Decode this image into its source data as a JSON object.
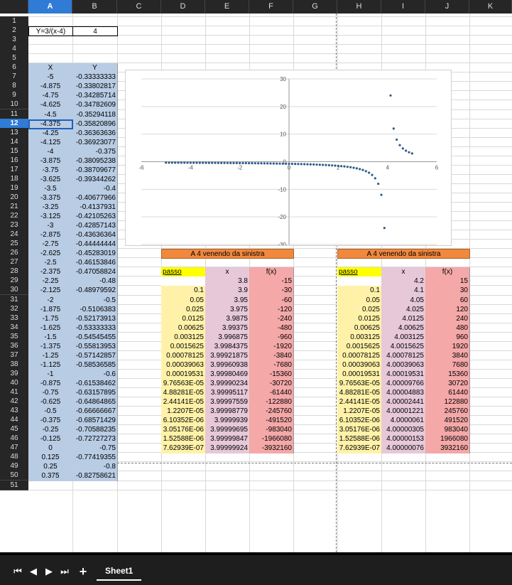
{
  "columns": [
    "A",
    "B",
    "C",
    "D",
    "E",
    "F",
    "G",
    "H",
    "I",
    "J",
    "K"
  ],
  "selected_column": "A",
  "selected_row": 12,
  "formula_label": "Y=3/(x-4)",
  "formula_value": "4",
  "xy_header": [
    "X",
    "Y"
  ],
  "xy_rows": [
    [
      "-5",
      "-0.33333333"
    ],
    [
      "-4.875",
      "-0.33802817"
    ],
    [
      "-4.75",
      "-0.34285714"
    ],
    [
      "-4.625",
      "-0.34782609"
    ],
    [
      "-4.5",
      "-0.35294118"
    ],
    [
      "-4.375",
      "-0.35820896"
    ],
    [
      "-4.25",
      "-0.36363636"
    ],
    [
      "-4.125",
      "-0.36923077"
    ],
    [
      "-4",
      "-0.375"
    ],
    [
      "-3.875",
      "-0.38095238"
    ],
    [
      "-3.75",
      "-0.38709677"
    ],
    [
      "-3.625",
      "-0.39344262"
    ],
    [
      "-3.5",
      "-0.4"
    ],
    [
      "-3.375",
      "-0.40677966"
    ],
    [
      "-3.25",
      "-0.4137931"
    ],
    [
      "-3.125",
      "-0.42105263"
    ],
    [
      "-3",
      "-0.42857143"
    ],
    [
      "-2.875",
      "-0.43636364"
    ],
    [
      "-2.75",
      "-0.44444444"
    ],
    [
      "-2.625",
      "-0.45283019"
    ],
    [
      "-2.5",
      "-0.46153846"
    ],
    [
      "-2.375",
      "-0.47058824"
    ],
    [
      "-2.25",
      "-0.48"
    ],
    [
      "-2.125",
      "-0.48979592"
    ],
    [
      "-2",
      "-0.5"
    ],
    [
      "-1.875",
      "-0.5106383"
    ],
    [
      "-1.75",
      "-0.52173913"
    ],
    [
      "-1.625",
      "-0.53333333"
    ],
    [
      "-1.5",
      "-0.54545455"
    ],
    [
      "-1.375",
      "-0.55813953"
    ],
    [
      "-1.25",
      "-0.57142857"
    ],
    [
      "-1.125",
      "-0.58536585"
    ],
    [
      "-1",
      "-0.6"
    ],
    [
      "-0.875",
      "-0.61538462"
    ],
    [
      "-0.75",
      "-0.63157895"
    ],
    [
      "-0.625",
      "-0.64864865"
    ],
    [
      "-0.5",
      "-0.66666667"
    ],
    [
      "-0.375",
      "-0.68571429"
    ],
    [
      "-0.25",
      "-0.70588235"
    ],
    [
      "-0.125",
      "-0.72727273"
    ],
    [
      "0",
      "-0.75"
    ],
    [
      "0.125",
      "-0.77419355"
    ],
    [
      "0.25",
      "-0.8"
    ],
    [
      "0.375",
      "-0.82758621"
    ]
  ],
  "left_table": {
    "title": "A 4 venendo da sinistra",
    "headers": [
      "passo",
      "x",
      "f(x)"
    ],
    "rows": [
      [
        "",
        "3.8",
        "-15"
      ],
      [
        "0.1",
        "3.9",
        "-30"
      ],
      [
        "0.05",
        "3.95",
        "-60"
      ],
      [
        "0.025",
        "3.975",
        "-120"
      ],
      [
        "0.0125",
        "3.9875",
        "-240"
      ],
      [
        "0.00625",
        "3.99375",
        "-480"
      ],
      [
        "0.003125",
        "3.996875",
        "-960"
      ],
      [
        "0.0015625",
        "3.9984375",
        "-1920"
      ],
      [
        "0.00078125",
        "3.99921875",
        "-3840"
      ],
      [
        "0.00039063",
        "3.99960938",
        "-7680"
      ],
      [
        "0.00019531",
        "3.99980469",
        "-15360"
      ],
      [
        "9.76563E-05",
        "3.99990234",
        "-30720"
      ],
      [
        "4.88281E-05",
        "3.99995117",
        "-61440"
      ],
      [
        "2.44141E-05",
        "3.99997559",
        "-122880"
      ],
      [
        "1.2207E-05",
        "3.99998779",
        "-245760"
      ],
      [
        "6.10352E-06",
        "3.9999939",
        "-491520"
      ],
      [
        "3.05176E-06",
        "3.99999695",
        "-983040"
      ],
      [
        "1.52588E-06",
        "3.99999847",
        "-1966080"
      ],
      [
        "7.62939E-07",
        "3.99999924",
        "-3932160"
      ]
    ]
  },
  "right_table": {
    "title": "A 4 venendo da sinistra",
    "headers": [
      "passo",
      "x",
      "f(x)"
    ],
    "rows": [
      [
        "",
        "4.2",
        "15"
      ],
      [
        "0.1",
        "4.1",
        "30"
      ],
      [
        "0.05",
        "4.05",
        "60"
      ],
      [
        "0.025",
        "4.025",
        "120"
      ],
      [
        "0.0125",
        "4.0125",
        "240"
      ],
      [
        "0.00625",
        "4.00625",
        "480"
      ],
      [
        "0.003125",
        "4.003125",
        "960"
      ],
      [
        "0.0015625",
        "4.0015625",
        "1920"
      ],
      [
        "0.00078125",
        "4.00078125",
        "3840"
      ],
      [
        "0.00039063",
        "4.00039063",
        "7680"
      ],
      [
        "0.00019531",
        "4.00019531",
        "15360"
      ],
      [
        "9.76563E-05",
        "4.00009766",
        "30720"
      ],
      [
        "4.88281E-05",
        "4.00004883",
        "61440"
      ],
      [
        "2.44141E-05",
        "4.00002441",
        "122880"
      ],
      [
        "1.2207E-05",
        "4.00001221",
        "245760"
      ],
      [
        "6.10352E-06",
        "4.0000061",
        "491520"
      ],
      [
        "3.05176E-06",
        "4.00000305",
        "983040"
      ],
      [
        "1.52588E-06",
        "4.00000153",
        "1966080"
      ],
      [
        "7.62939E-07",
        "4.00000076",
        "3932160"
      ]
    ]
  },
  "colors": {
    "xy_fill": "#b8cce4",
    "title_fill": "#f0883e",
    "passo_header_fill": "#ffff00",
    "passo_fill": "#fff2a8",
    "x_fill": "#e6c8d8",
    "fx_fill": "#f4a8a8",
    "marker": "#2e5c8a"
  },
  "chart_data": {
    "type": "scatter",
    "x_ticks": [
      -6,
      -4,
      -2,
      0,
      2,
      4,
      6
    ],
    "y_ticks": [
      30,
      20,
      10,
      0,
      -10,
      -20,
      -30
    ],
    "xlim": [
      -6,
      6
    ],
    "ylim": [
      -30,
      30
    ],
    "grid": "horizontal",
    "points_x": [
      -5,
      -4.875,
      -4.75,
      -4.625,
      -4.5,
      -4.375,
      -4.25,
      -4.125,
      -4,
      -3.875,
      -3.75,
      -3.625,
      -3.5,
      -3.375,
      -3.25,
      -3.125,
      -3,
      -2.875,
      -2.75,
      -2.625,
      -2.5,
      -2.375,
      -2.25,
      -2.125,
      -2,
      -1.875,
      -1.75,
      -1.625,
      -1.5,
      -1.375,
      -1.25,
      -1.125,
      -1,
      -0.875,
      -0.75,
      -0.625,
      -0.5,
      -0.375,
      -0.25,
      -0.125,
      0,
      0.125,
      0.25,
      0.375,
      0.5,
      0.625,
      0.75,
      0.875,
      1,
      1.125,
      1.25,
      1.375,
      1.5,
      1.625,
      1.75,
      1.875,
      2,
      2.125,
      2.25,
      2.375,
      2.5,
      2.625,
      2.75,
      2.875,
      3,
      3.125,
      3.25,
      3.375,
      3.5,
      3.625,
      3.75,
      3.875,
      4.125,
      4.25,
      4.375,
      4.5,
      4.625,
      4.75,
      4.875,
      5
    ],
    "function": "y=3/(x-4)"
  },
  "sheet_tab": "Sheet1"
}
